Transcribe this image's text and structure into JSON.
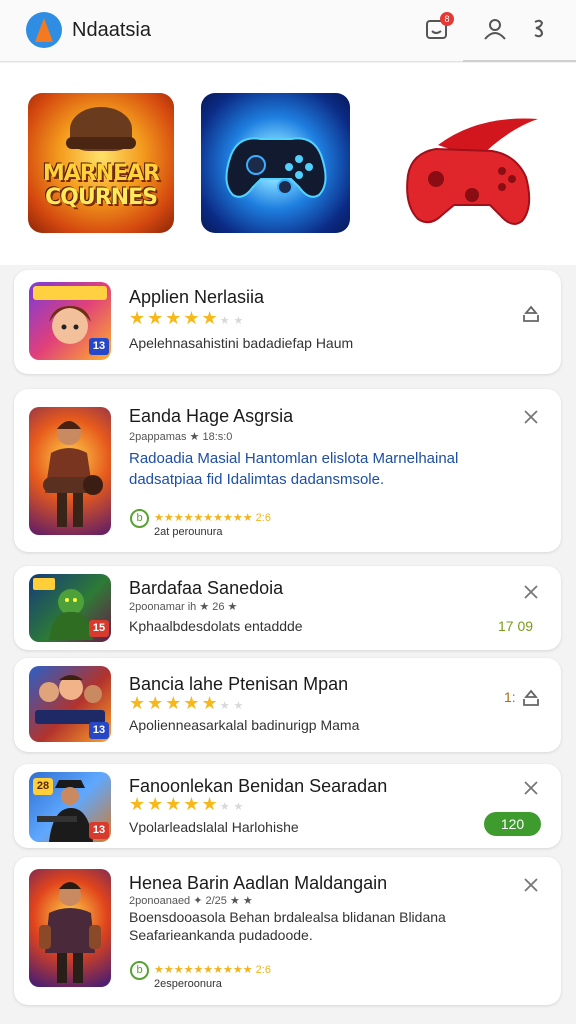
{
  "header": {
    "app_title": "Ndaatsia",
    "notification_count": "8",
    "icons": [
      "logo-icon",
      "notification-icon",
      "profile-icon",
      "more-icon"
    ]
  },
  "banner": {
    "promo1_line1": "MARNEAR",
    "promo1_line2": "CQURNES"
  },
  "cards": [
    {
      "title": "Applien Nerlasiia",
      "rating": 4,
      "description": "Apelehnasahistini badadiefap Haum",
      "thumb_badge": "13",
      "action_icon": "share-icon"
    },
    {
      "title": "Eanda Hage Asgrsia",
      "meta": "2pappamas ★ 18:s:0",
      "description_line1": "Radoadia Masial Hantomlan elislota Marnelhainal",
      "description_line2": "dadsatpiaa fid Idalimtas dadansmsole.",
      "small_stars": "★★★★★★★★★★ 2:6",
      "rating_icon_letter": "b",
      "sub": "2at perounura",
      "action_icon": "close-icon"
    },
    {
      "title": "Bardafaa Sanedoia",
      "meta": "2poonamar ih ★ 26 ★",
      "description": "Kphaalbdesdolats entaddde",
      "thumb_badge": "15",
      "trailing_value": "17 09",
      "action_icon": "close-icon"
    },
    {
      "title": "Bancia lahe Ptenisan Mpan",
      "rating": 4,
      "description": "Apolienneasarkalal badinurigp Mama",
      "thumb_badge": "13",
      "trailing_value": "1:",
      "action_icon": "share-icon"
    },
    {
      "title": "Fanoonlekan Benidan Searadan",
      "rating": 4,
      "description": "Vpolarleadslalal Harlohishe",
      "thumb_badge": "13",
      "thumb_text": "28",
      "pill_value": "120",
      "action_icon": "close-icon"
    },
    {
      "title": "Henea Barin  Aadlan Maldangain",
      "meta": "2ponoanaed ✦ 2/25 ★ ★",
      "description_line1": "Boensdooasola Behan brdalealsa blidanan Blidana",
      "description_line2": "Seafarieankanda pudadoode.",
      "small_stars": "★★★★★★★★★★ 2:6",
      "rating_icon_letter": "b",
      "sub": "2esperoonura",
      "action_icon": "close-icon"
    }
  ],
  "colors": {
    "accent_blue": "#2f8de4",
    "star_yellow": "#f6b81a",
    "pill_green": "#3e9b2e",
    "link_blue": "#1e4fa3"
  }
}
